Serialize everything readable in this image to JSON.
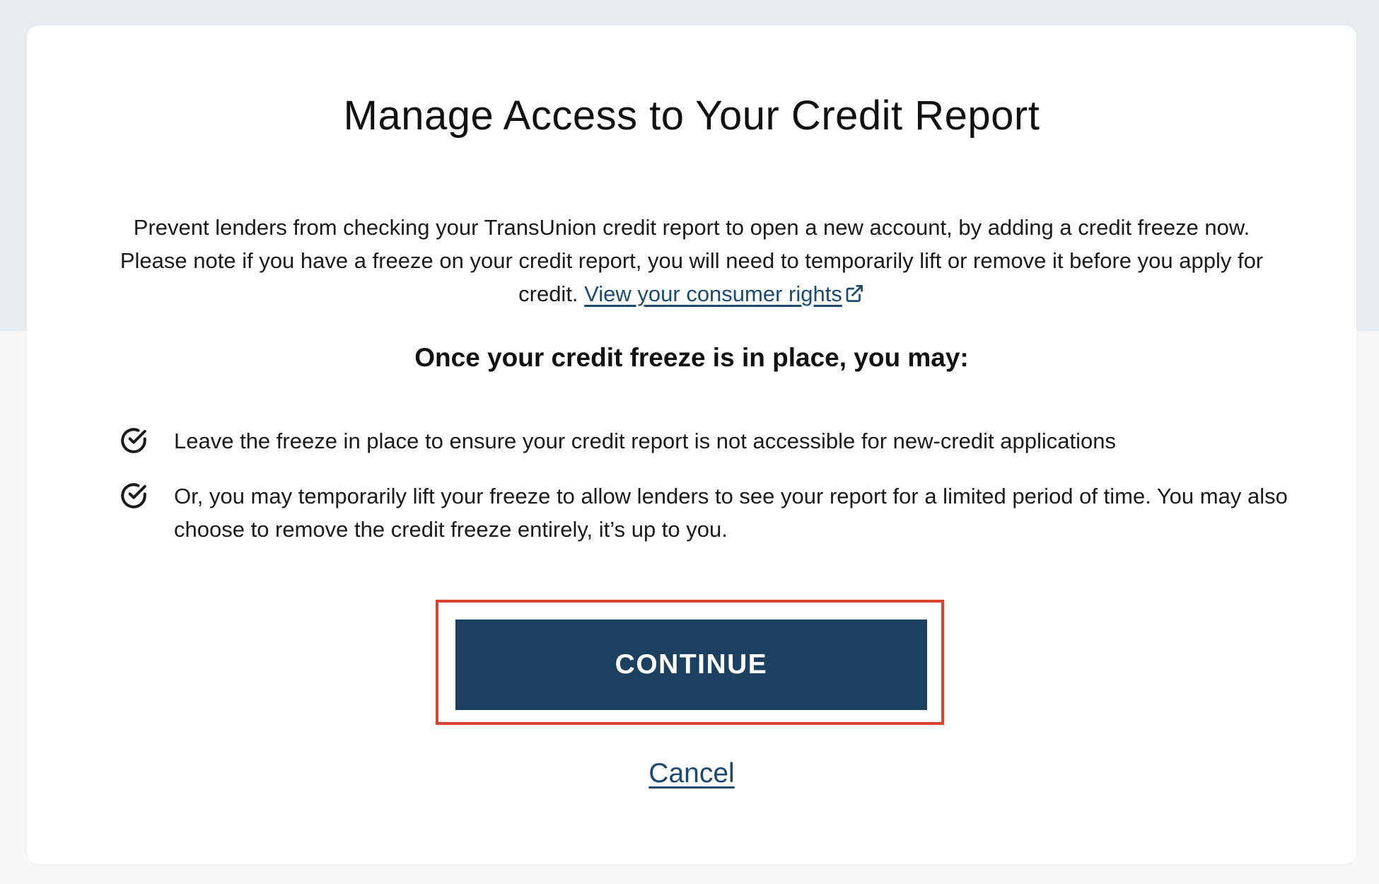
{
  "modal": {
    "title": "Manage Access to Your Credit Report",
    "intro_text": "Prevent lenders from checking your TransUnion credit report to open a new account, by adding a credit freeze now. Please note if you have a freeze on your credit report, you will need to temporarily lift or remove it before you apply for credit. ",
    "rights_link": "View your consumer rights",
    "rights_link_icon": "external-link-icon",
    "subheading": "Once your credit freeze is in place, you may:",
    "benefits": [
      {
        "icon": "check-circle-icon",
        "text": "Leave the freeze in place to ensure your credit report is not accessible for new-credit applications"
      },
      {
        "icon": "check-circle-icon",
        "text": "Or, you may temporarily lift your freeze to allow lenders to see your report for a limited period of time. You may also choose to remove the credit freeze entirely, it’s up to you."
      }
    ],
    "continue_label": "CONTINUE",
    "cancel_label": "Cancel"
  },
  "colors": {
    "page_background_top": "#e8edf0",
    "page_background_bottom": "#f7f8f8",
    "card_background": "#ffffff",
    "primary_button": "#1b4060",
    "link": "#1b4a73",
    "highlight_border": "#d9432f"
  }
}
